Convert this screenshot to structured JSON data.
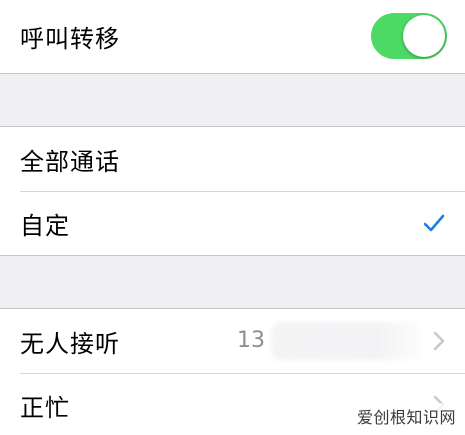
{
  "call_forwarding": {
    "label": "呼叫转移",
    "enabled": true
  },
  "scope": {
    "all_calls_label": "全部通话",
    "custom_label": "自定",
    "selected": "自定"
  },
  "conditions": {
    "no_answer_label": "无人接听",
    "no_answer_value": "13",
    "busy_label": "正忙"
  },
  "watermark": "爱创根知识网",
  "colors": {
    "toggle_on": "#4cd964",
    "checkmark": "#1f7fe0",
    "chevron": "#c7c7cc"
  },
  "icons": {
    "checkmark": "checkmark-icon",
    "chevron": "chevron-right-icon"
  }
}
